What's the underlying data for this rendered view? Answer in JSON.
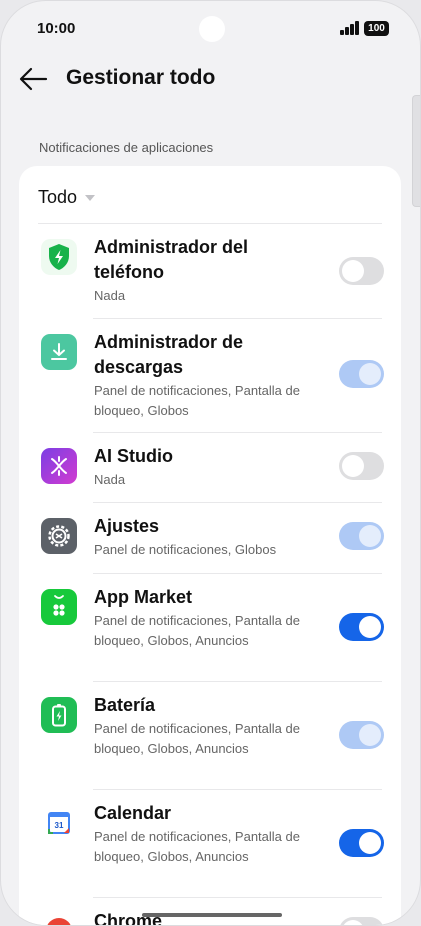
{
  "status_bar": {
    "time": "10:00",
    "battery": "100"
  },
  "header": {
    "title": "Gestionar todo"
  },
  "section": {
    "label": "Notificaciones de aplicaciones"
  },
  "filter": {
    "label": "Todo"
  },
  "apps": [
    {
      "name": "Administrador del teléfono",
      "sub": "Nada",
      "toggle": "off",
      "icon": "shield-bolt-icon"
    },
    {
      "name": "Administrador de descargas",
      "sub": "Panel de notificaciones, Pantalla de bloqueo, Globos",
      "toggle": "on-disabled",
      "icon": "download-icon"
    },
    {
      "name": "AI Studio",
      "sub": "Nada",
      "toggle": "off",
      "icon": "ai-studio-icon"
    },
    {
      "name": "Ajustes",
      "sub": "Panel de notificaciones, Globos",
      "toggle": "on-disabled",
      "icon": "gear-icon"
    },
    {
      "name": "App Market",
      "sub": "Panel de notificaciones, Pantalla de bloqueo, Globos, Anuncios",
      "toggle": "on",
      "icon": "app-market-icon"
    },
    {
      "name": "Batería",
      "sub": "Panel de notificaciones, Pantalla de bloqueo, Globos, Anuncios",
      "toggle": "on-disabled",
      "icon": "battery-icon"
    },
    {
      "name": "Calendar",
      "sub": "Panel de notificaciones, Pantalla de bloqueo, Globos, Anuncios",
      "toggle": "on",
      "icon": "calendar-icon",
      "icon_text": "31"
    },
    {
      "name": "Chrome",
      "sub": "",
      "toggle": "off",
      "icon": "chrome-icon"
    }
  ],
  "colors": {
    "toggle_on": "#1565e8",
    "toggle_on_disabled": "#aec9f5",
    "toggle_off": "#dedee0",
    "background": "#f2f2f4",
    "card": "#ffffff"
  }
}
